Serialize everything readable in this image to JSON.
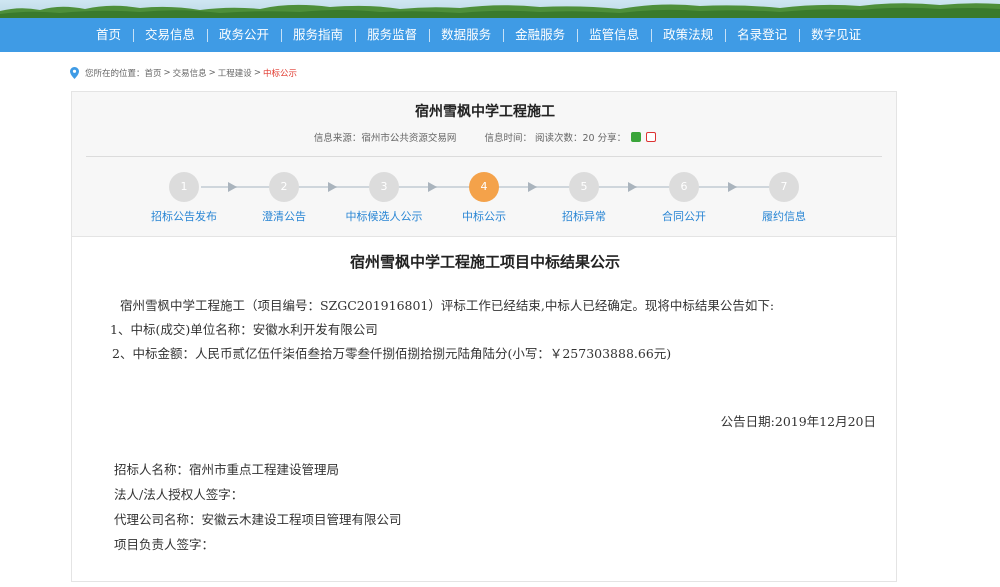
{
  "nav": {
    "items": [
      "首页",
      "交易信息",
      "政务公开",
      "服务指南",
      "服务监督",
      "数据服务",
      "金融服务",
      "监管信息",
      "政策法规",
      "名录登记",
      "数字见证"
    ]
  },
  "breadcrumb": {
    "prefix": "您所在的位置：",
    "items": [
      "首页",
      "交易信息",
      "工程建设"
    ],
    "current": "中标公示",
    "sep": ">"
  },
  "header": {
    "title": "宿州雪枫中学工程施工",
    "source": "信息来源：宿州市公共资源交易网",
    "time_reads": "信息时间：  阅读次数：20 分享："
  },
  "steps": [
    {
      "num": "1",
      "label": "招标公告发布"
    },
    {
      "num": "2",
      "label": "澄清公告"
    },
    {
      "num": "3",
      "label": "中标候选人公示"
    },
    {
      "num": "4",
      "label": "中标公示"
    },
    {
      "num": "5",
      "label": "招标异常"
    },
    {
      "num": "6",
      "label": "合同公开"
    },
    {
      "num": "7",
      "label": "履约信息"
    }
  ],
  "active_step": 4,
  "colors": {
    "nav": "#3f9be5",
    "active_step": "#f4a24a",
    "step_label": "#2a86d4",
    "crumb_current": "#e03a2f"
  },
  "doc": {
    "title": "宿州雪枫中学工程施工项目中标结果公示",
    "intro": "宿州雪枫中学工程施工（项目编号：SZGC201916801）评标工作已经结束,中标人已经确定。现将中标结果公告如下:",
    "line1": "1、中标(成交)单位名称：安徽水利开发有限公司",
    "line2": "2、中标金额：人民币贰亿伍仟柒佰叁拾万零叁仟捌佰捌拾捌元陆角陆分(小写：￥257303888.66元)",
    "date": "公告日期:2019年12月20日",
    "tenderer": "招标人名称：宿州市重点工程建设管理局",
    "legal_sign": "法人/法人授权人签字：",
    "agency": "代理公司名称：安徽云木建设工程项目管理有限公司",
    "pm_sign": "项目负责人签字："
  }
}
